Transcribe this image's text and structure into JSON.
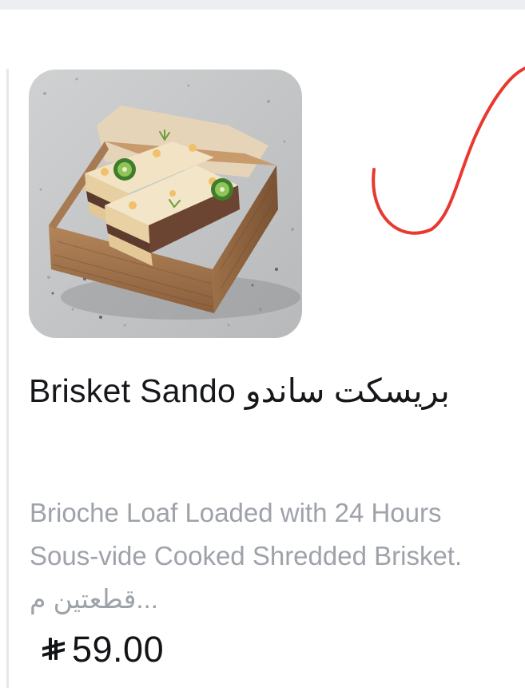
{
  "product": {
    "title": "Brisket Sando بريسكت ساندو",
    "description": "Brioche Loaf Loaded with 24 Hours Sous-vide Cooked Shredded Brisket. قطعتين م...",
    "price": "59.00",
    "currency_icon": "saudi-riyal-icon",
    "image_subject": "brisket sandwich halves with jalapeño slices in a wooden box on a granite surface"
  },
  "annotation": {
    "color": "#e8392e",
    "shape": "checkmark"
  },
  "colors": {
    "title": "#15171a",
    "description": "#9ea2a9",
    "price": "#121417",
    "top_strip": "#eceef2"
  }
}
